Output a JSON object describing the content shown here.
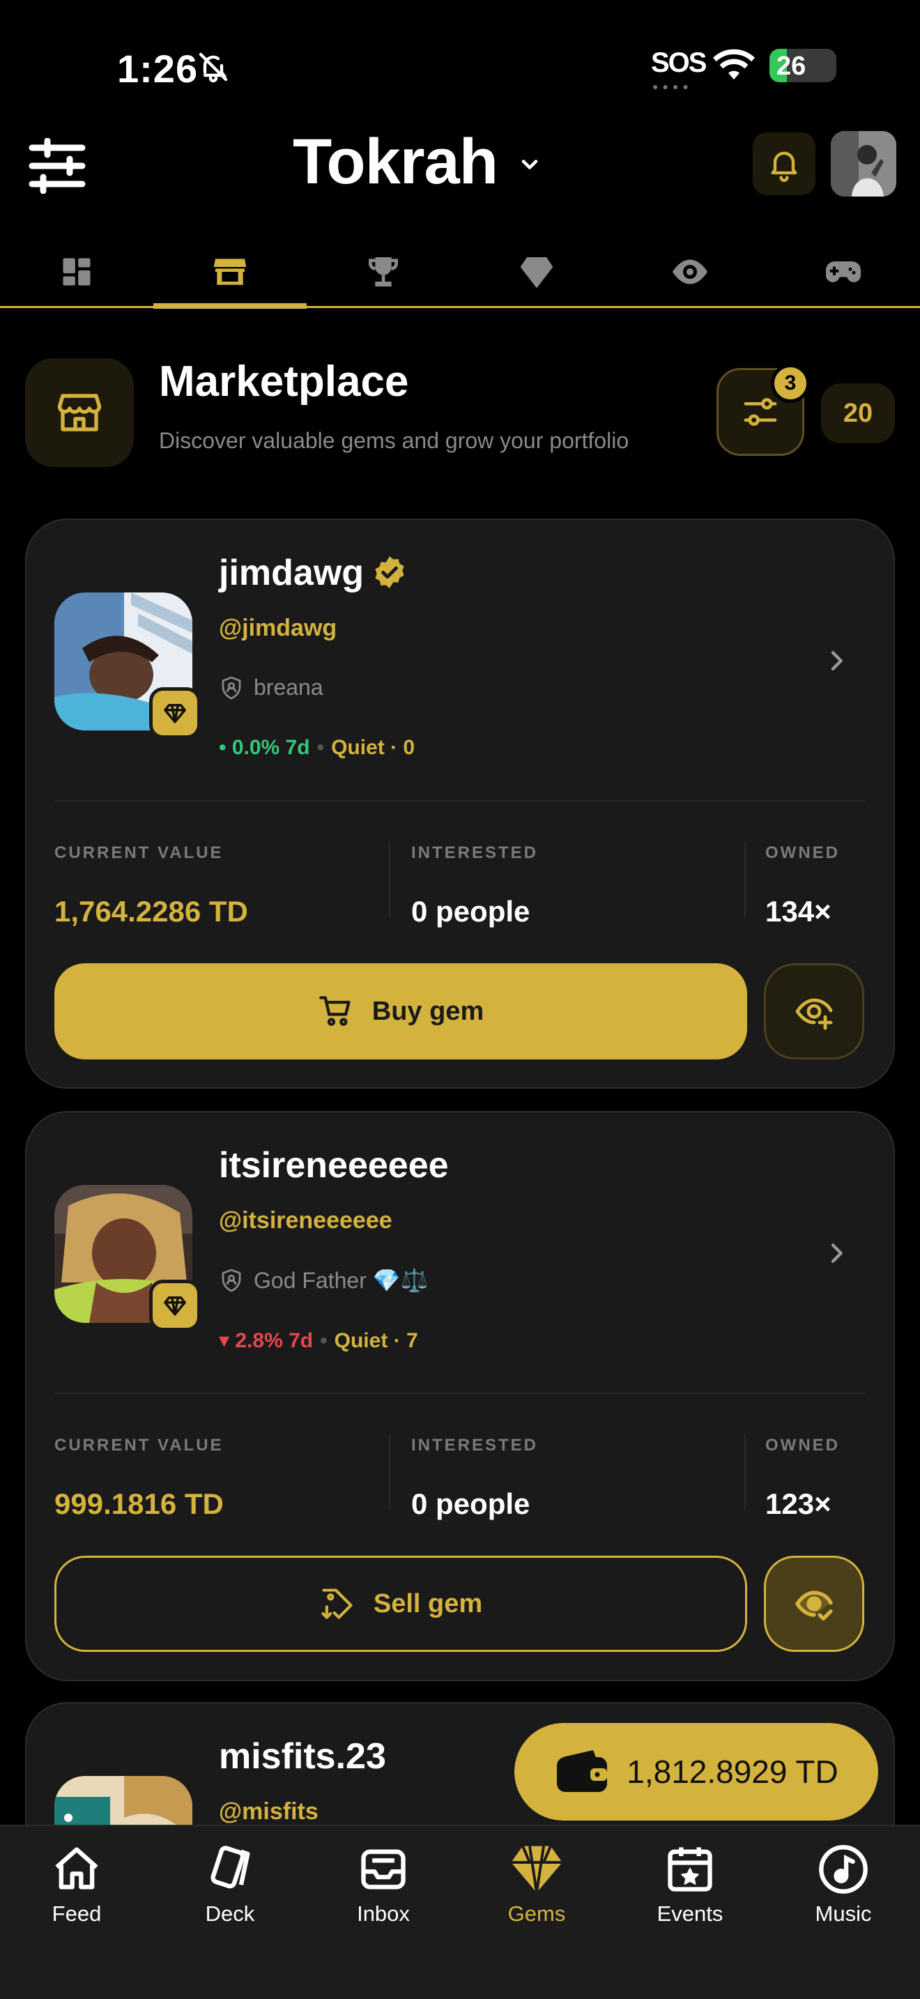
{
  "status": {
    "time": "1:26",
    "sos": "SOS",
    "battery": "26",
    "battery_level": 0.26
  },
  "header": {
    "title": "Tokrah"
  },
  "tabs": [
    {
      "icon": "dashboard-icon",
      "active": false
    },
    {
      "icon": "store-icon",
      "active": true
    },
    {
      "icon": "trophy-icon",
      "active": false
    },
    {
      "icon": "diamond-icon",
      "active": false
    },
    {
      "icon": "eye-icon",
      "active": false
    },
    {
      "icon": "gamepad-icon",
      "active": false
    }
  ],
  "marketplace": {
    "title": "Marketplace",
    "subtitle": "Discover valuable gems and grow your portfolio",
    "filter_badge": "3",
    "count": "20"
  },
  "gems": [
    {
      "name": "jimdawg",
      "verified": true,
      "handle": "@jimdawg",
      "owner": "breana",
      "change": "• 0.0% 7d",
      "change_dir": "flat",
      "activity": "Quiet · 0",
      "current_value_label": "CURRENT VALUE",
      "current_value": "1,764.2286 TD",
      "interested_label": "INTERESTED",
      "interested": "0 people",
      "owned_label": "OWNED",
      "owned": "134×",
      "action": "Buy gem",
      "watching": false
    },
    {
      "name": "itsireneeeeee",
      "verified": false,
      "handle": "@itsireneeeeee",
      "owner": "God Father 💎⚖️",
      "change": "▾ 2.8% 7d",
      "change_dir": "down",
      "activity": "Quiet · 7",
      "current_value_label": "CURRENT VALUE",
      "current_value": "999.1816 TD",
      "interested_label": "INTERESTED",
      "interested": "0 people",
      "owned_label": "OWNED",
      "owned": "123×",
      "action": "Sell gem",
      "watching": true
    },
    {
      "name": "misfits.23",
      "handle": "@misfits"
    }
  ],
  "wallet": {
    "balance": "1,812.8929 TD"
  },
  "nav": [
    {
      "label": "Feed",
      "icon": "home-icon"
    },
    {
      "label": "Deck",
      "icon": "cards-icon"
    },
    {
      "label": "Inbox",
      "icon": "inbox-icon"
    },
    {
      "label": "Gems",
      "icon": "gem-icon",
      "active": true
    },
    {
      "label": "Events",
      "icon": "calendar-icon"
    },
    {
      "label": "Music",
      "icon": "music-icon"
    }
  ],
  "colors": {
    "accent": "#d4b23e",
    "background": "#000000",
    "card": "#1a1a1a",
    "positive": "#34c77b",
    "negative": "#e5474f"
  }
}
